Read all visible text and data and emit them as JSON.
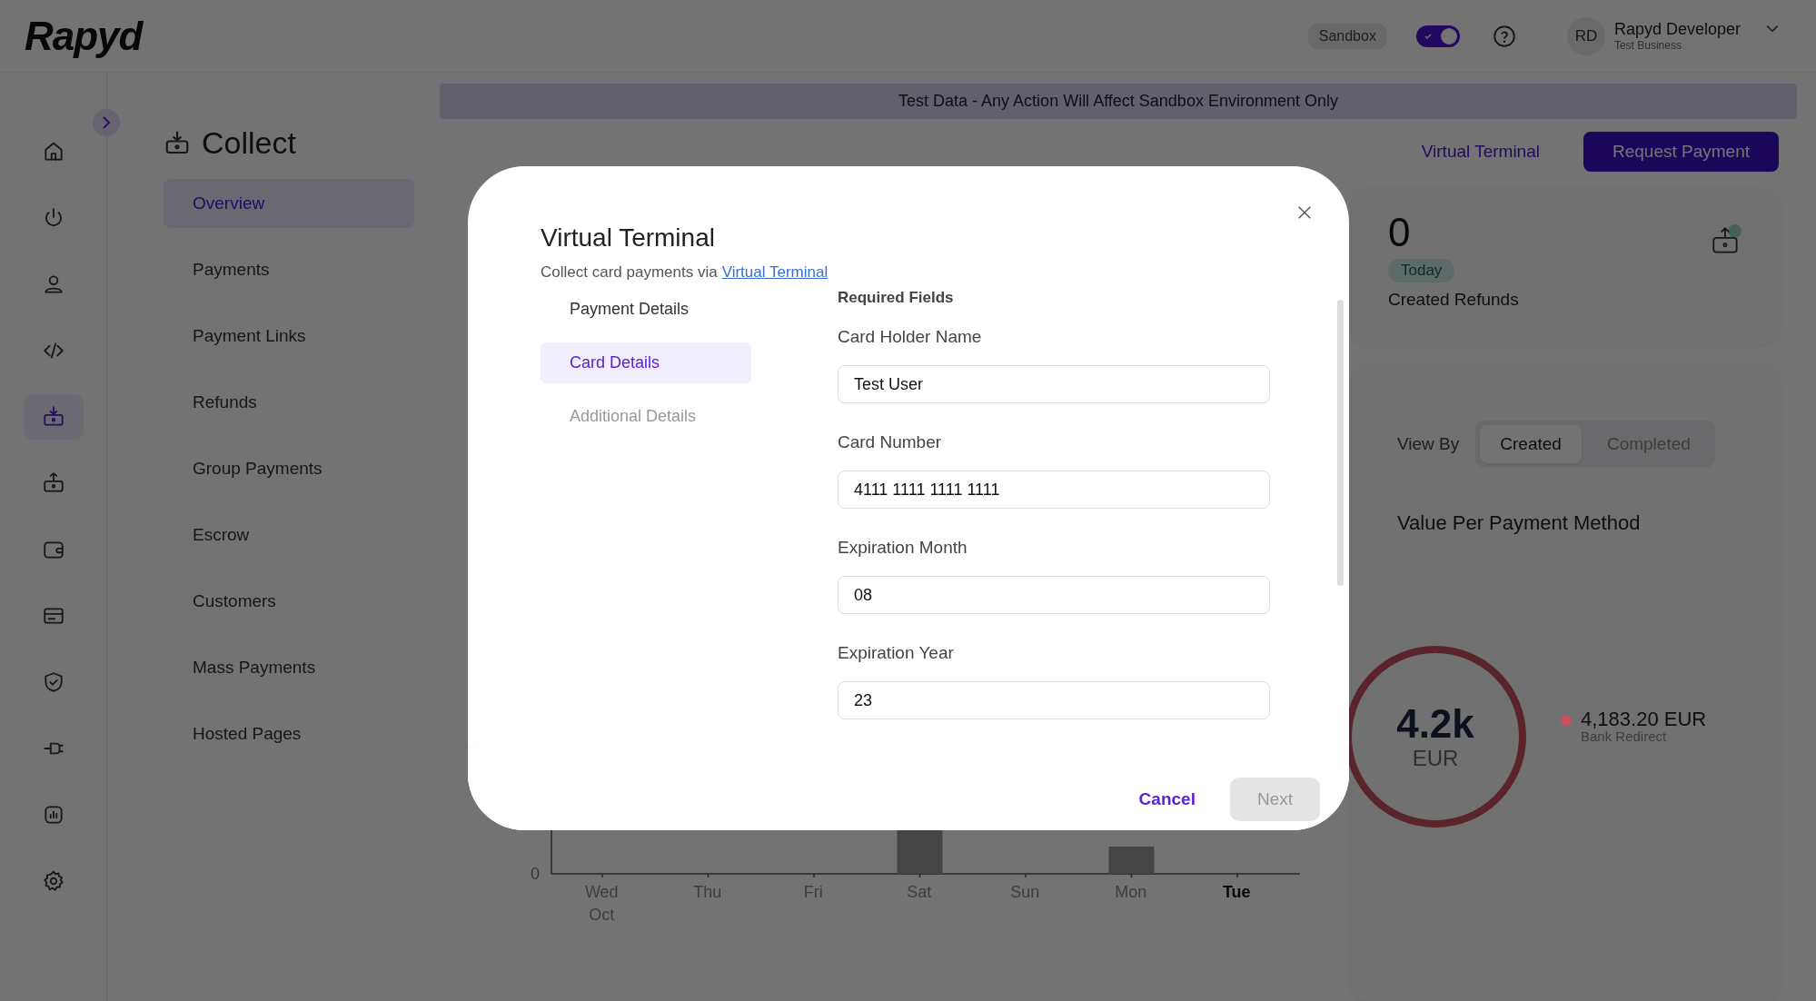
{
  "topbar": {
    "logo": "Rapyd",
    "environment_badge": "Sandbox",
    "sandbox_toggle": {
      "on": true
    },
    "user": {
      "initials": "RD",
      "name": "Rapyd Developer",
      "business": "Test Business"
    }
  },
  "rail": [
    {
      "kind": "home",
      "selected": false
    },
    {
      "kind": "power",
      "selected": false
    },
    {
      "kind": "user",
      "selected": false
    },
    {
      "kind": "code",
      "selected": false
    },
    {
      "kind": "collect",
      "selected": true
    },
    {
      "kind": "disburse",
      "selected": false
    },
    {
      "kind": "wallet",
      "selected": false
    },
    {
      "kind": "card",
      "selected": false
    },
    {
      "kind": "shield",
      "selected": false
    },
    {
      "kind": "plug",
      "selected": false
    },
    {
      "kind": "report",
      "selected": false
    },
    {
      "kind": "settings",
      "selected": false
    }
  ],
  "submenu": {
    "title": "Collect",
    "items": [
      {
        "label": "Overview",
        "selected": true
      },
      {
        "label": "Payments",
        "selected": false
      },
      {
        "label": "Payment Links",
        "selected": false
      },
      {
        "label": "Refunds",
        "selected": false
      },
      {
        "label": "Group Payments",
        "selected": false
      },
      {
        "label": "Escrow",
        "selected": false
      },
      {
        "label": "Customers",
        "selected": false
      },
      {
        "label": "Mass Payments",
        "selected": false
      },
      {
        "label": "Hosted Pages",
        "selected": false
      }
    ]
  },
  "banner": "Test Data - Any Action Will Affect Sandbox Environment Only",
  "header_actions": {
    "link": "Virtual Terminal",
    "button": "Request Payment"
  },
  "stat_card": {
    "value": "0",
    "period": "Today",
    "label": "Created Refunds"
  },
  "view_by": {
    "label": "View By",
    "options": [
      {
        "label": "Created",
        "selected": true
      },
      {
        "label": "Completed",
        "selected": false
      }
    ]
  },
  "payment_method_panel": {
    "title": "Value Per Payment Method",
    "total": "4.2k",
    "currency": "EUR",
    "legend": [
      {
        "amount": "4,183.20 EUR",
        "method": "Bank Redirect",
        "color": "#c8505f"
      }
    ]
  },
  "daily_chart": {
    "y_tick": "0",
    "days": [
      {
        "day": "Wed",
        "month": "Oct",
        "current": false
      },
      {
        "day": "Thu",
        "current": false
      },
      {
        "day": "Fri",
        "current": false
      },
      {
        "day": "Sat",
        "current": false
      },
      {
        "day": "Sun",
        "current": false
      },
      {
        "day": "Mon",
        "current": false
      },
      {
        "day": "Tue",
        "current": true
      }
    ]
  },
  "modal": {
    "title": "Virtual Terminal",
    "subtitle": "Collect card payments via",
    "subtitle_link": "Virtual Terminal",
    "steps": [
      {
        "label": "Payment Details",
        "selected": false,
        "disabled": false
      },
      {
        "label": "Card Details",
        "selected": true,
        "disabled": false
      },
      {
        "label": "Additional Details",
        "selected": false,
        "disabled": true
      }
    ],
    "section": "Required Fields",
    "fields": [
      {
        "label": "Card Holder Name",
        "value": "Test User"
      },
      {
        "label": "Card Number",
        "value": "4111 1111 1111 1111"
      },
      {
        "label": "Expiration Month",
        "value": "08"
      },
      {
        "label": "Expiration Year",
        "value": "23"
      }
    ],
    "cancel": "Cancel",
    "next": {
      "label": "Next",
      "disabled": true
    }
  }
}
